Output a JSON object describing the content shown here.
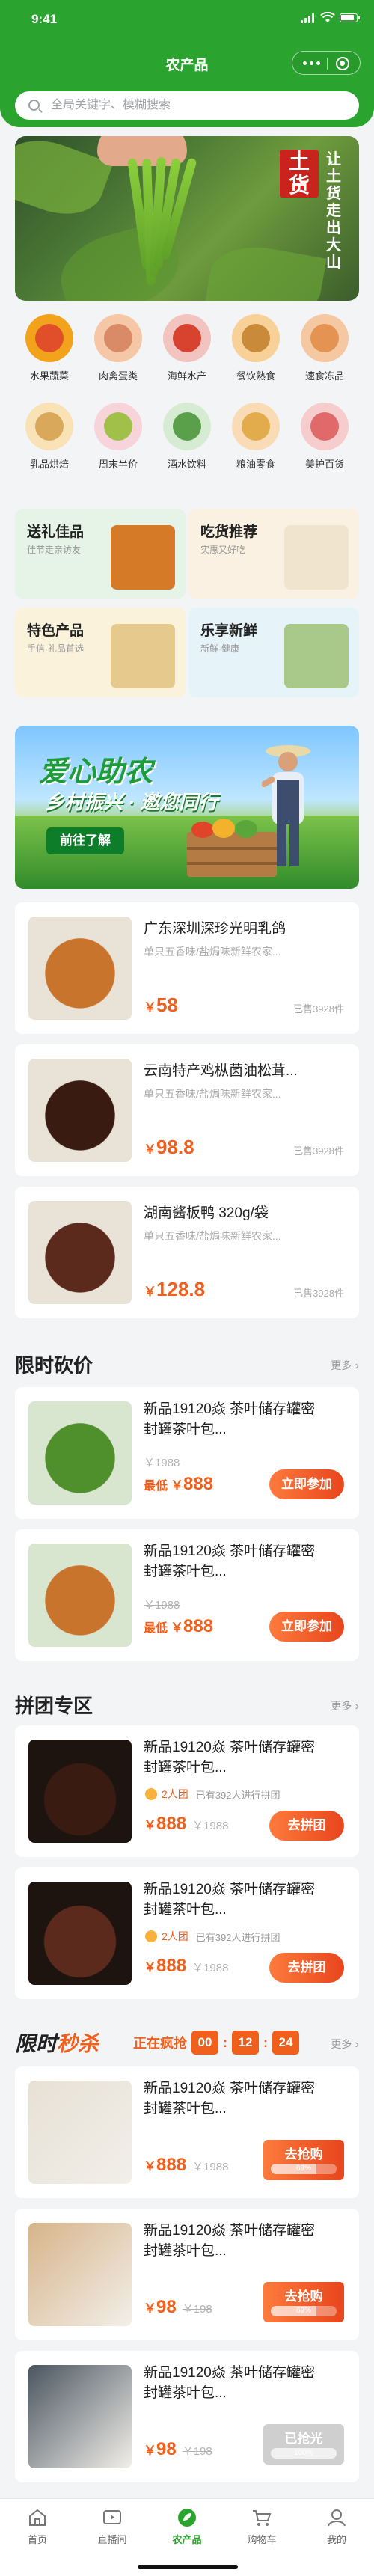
{
  "status_bar": {
    "time": "9:41"
  },
  "nav": {
    "title": "农产品"
  },
  "search": {
    "placeholder": "全局关键字、模糊搜索"
  },
  "banner": {
    "seal": "土货",
    "vertical_text": "让土货走出大山"
  },
  "categories": [
    {
      "label": "水果蔬菜",
      "color": "#f3a21c",
      "inner": "#e04f2a"
    },
    {
      "label": "肉禽蛋类",
      "color": "#f6c7a6",
      "inner": "#d98a67"
    },
    {
      "label": "海鲜水产",
      "color": "#f1c4c0",
      "inner": "#d8432f"
    },
    {
      "label": "餐饮熟食",
      "color": "#f7d197",
      "inner": "#c98a3a"
    },
    {
      "label": "速食冻品",
      "color": "#f5c8a2",
      "inner": "#e59353"
    },
    {
      "label": "乳品烘焙",
      "color": "#f8e2b6",
      "inner": "#d9a85a"
    },
    {
      "label": "周末半价",
      "color": "#f6d4da",
      "inner": "#a0c04a"
    },
    {
      "label": "酒水饮料",
      "color": "#d6ecd2",
      "inner": "#5aa04a"
    },
    {
      "label": "粮油零食",
      "color": "#f9dcb6",
      "inner": "#e2ab4c"
    },
    {
      "label": "美护百货",
      "color": "#f7cccc",
      "inner": "#e06a6a"
    }
  ],
  "promos": [
    {
      "title": "送礼佳品",
      "subtitle": "佳节走亲访友",
      "bg": "#e6f4e8",
      "pic": "#d57a27"
    },
    {
      "title": "吃货推荐",
      "subtitle": "实惠又好吃",
      "bg": "#fbf1e3",
      "pic": "#f0e4cf"
    },
    {
      "title": "特色产品",
      "subtitle": "手信·礼品首选",
      "bg": "#fbf2dc",
      "pic": "#e6c98d"
    },
    {
      "title": "乐享新鲜",
      "subtitle": "新鲜·健康",
      "bg": "#e6f3f8",
      "pic": "#a8c98a"
    }
  ],
  "ad": {
    "headline": "爱心助农",
    "subline": "乡村振兴 · 邀您同行",
    "button": "前往了解"
  },
  "products": [
    {
      "name": "广东深圳深珍光明乳鸽",
      "sub": "单只五香味/盐焗味新鲜农家...",
      "yen": "￥",
      "price": "58",
      "sold": "已售3928件",
      "thumb": "#c9742d"
    },
    {
      "name": "云南特产鸡枞菌油松茸...",
      "sub": "单只五香味/盐焗味新鲜农家...",
      "yen": "￥",
      "price": "98.8",
      "sold": "已售3928件",
      "thumb": "#3a1b12"
    },
    {
      "name": "湖南酱板鸭 320g/袋",
      "sub": "单只五香味/盐焗味新鲜农家...",
      "yen": "￥",
      "price": "128.8",
      "sold": "已售3928件",
      "thumb": "#5c2a1c"
    }
  ],
  "bargain": {
    "title": "限时砍价",
    "more": "更多",
    "items": [
      {
        "name_line1": "新品19120焱 茶叶储存罐密",
        "name_line2": "封罐茶叶包...",
        "old": "￥1988",
        "low_label": "最低",
        "yen": "￥",
        "price": "888",
        "button": "立即参加",
        "thumb": "#4f8f2c"
      },
      {
        "name_line1": "新品19120焱 茶叶储存罐密",
        "name_line2": "封罐茶叶包...",
        "old": "￥1988",
        "low_label": "最低",
        "yen": "￥",
        "price": "888",
        "button": "立即参加",
        "thumb": "#c9742d"
      }
    ]
  },
  "group": {
    "title": "拼团专区",
    "more": "更多",
    "items": [
      {
        "name_line1": "新品19120焱 茶叶储存罐密",
        "name_line2": "封罐茶叶包...",
        "group_size": "2人团",
        "joined": "已有392人进行拼团",
        "yen": "￥",
        "price": "888",
        "old": "￥1988",
        "button": "去拼团",
        "thumb": "#3a1b12"
      },
      {
        "name_line1": "新品19120焱 茶叶储存罐密",
        "name_line2": "封罐茶叶包...",
        "group_size": "2人团",
        "joined": "已有392人进行拼团",
        "yen": "￥",
        "price": "888",
        "old": "￥1988",
        "button": "去拼团",
        "thumb": "#5c2a1c"
      }
    ]
  },
  "flash": {
    "title_a": "限时",
    "title_b": "秒杀",
    "running": "正在疯抢",
    "hh": "00",
    "mm": "12",
    "ss": "24",
    "more": "更多",
    "items": [
      {
        "name_line1": "新品19120焱 茶叶储存罐密",
        "name_line2": "封罐茶叶包...",
        "yen": "￥",
        "price": "888",
        "old": "￥1988",
        "button": "去抢购",
        "percent_text": "69%",
        "percent": 0.69,
        "sold_out": false,
        "thumb": "#e7e1d5"
      },
      {
        "name_line1": "新品19120焱 茶叶储存罐密",
        "name_line2": "封罐茶叶包...",
        "yen": "￥",
        "price": "98",
        "old": "￥198",
        "button": "去抢购",
        "percent_text": "69%",
        "percent": 0.69,
        "sold_out": false,
        "thumb": "#d7b48a"
      },
      {
        "name_line1": "新品19120焱 茶叶储存罐密",
        "name_line2": "封罐茶叶包...",
        "yen": "￥",
        "price": "98",
        "old": "￥198",
        "button": "已抢光",
        "percent_text": "100%",
        "percent": 1.0,
        "sold_out": true,
        "thumb": "#4a5560"
      }
    ]
  },
  "tabbar": [
    {
      "label": "首页",
      "icon": "home-icon"
    },
    {
      "label": "直播间",
      "icon": "live-icon"
    },
    {
      "label": "农产品",
      "icon": "produce-icon",
      "active": true
    },
    {
      "label": "购物车",
      "icon": "cart-icon"
    },
    {
      "label": "我的",
      "icon": "user-icon"
    }
  ],
  "colors": {
    "brand_green": "#2aa42e",
    "accent_orange": "#f0601c"
  }
}
